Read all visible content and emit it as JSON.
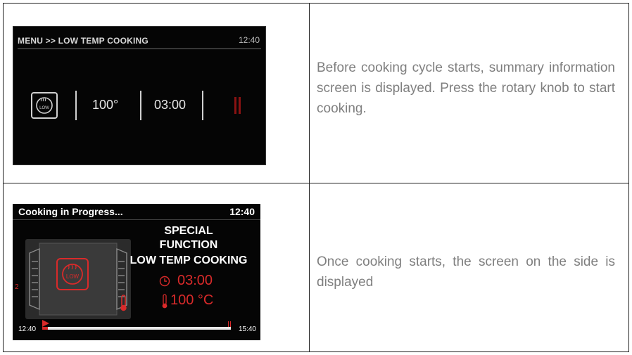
{
  "row1": {
    "screen": {
      "breadcrumb": "MENU >> LOW TEMP COOKING",
      "clock": "12:40",
      "temperature": "100°",
      "duration": "03:00",
      "function_icon": "low-temp-icon",
      "status_icon": "pause-icon"
    },
    "description": "Before cooking cycle starts, summary information screen is displayed. Press the rotary knob to start cooking."
  },
  "row2": {
    "screen": {
      "title": "Cooking in Progress...",
      "clock": "12:40",
      "special_line1": "SPECIAL",
      "special_line2": "FUNCTION",
      "function_name": "LOW TEMP COOKING",
      "timer": "03:00",
      "temperature": "100 °C",
      "shelf_level": "2",
      "start_time": "12:40",
      "end_time": "15:40",
      "progress": 0.03,
      "function_icon": "low-temp-icon",
      "clock_icon": "clock-icon",
      "thermometer_icon": "thermometer-icon"
    },
    "description": "Once cooking starts, the screen on the side is displayed"
  },
  "colors": {
    "accent_red": "#d92a2a",
    "description_text": "#7f7f7f",
    "screen_bg": "#050505"
  }
}
